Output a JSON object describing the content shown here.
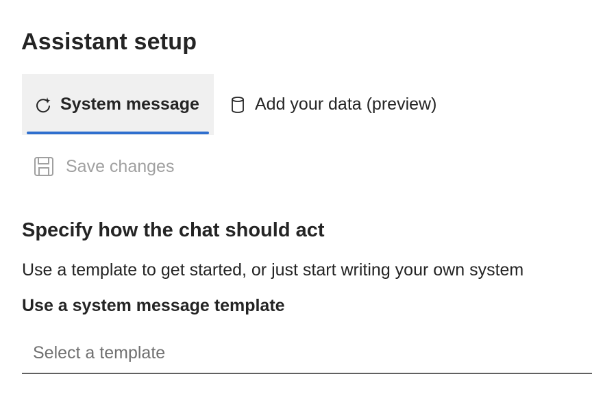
{
  "header": {
    "title": "Assistant setup"
  },
  "tabs": [
    {
      "label": "System message",
      "icon": "sparkle-refresh-icon",
      "selected": true
    },
    {
      "label": "Add your data (preview)",
      "icon": "database-icon",
      "selected": false
    }
  ],
  "toolbar": {
    "save_label": "Save changes",
    "save_icon": "save-icon",
    "save_disabled": true
  },
  "section": {
    "title": "Specify how the chat should act",
    "description": "Use a template to get started, or just start writing your own system"
  },
  "template_field": {
    "label": "Use a system message template",
    "placeholder": "Select a template"
  },
  "colors": {
    "accent": "#2f6fce",
    "tab_selected_bg": "#f0f0f0",
    "disabled_text": "#a0a0a0"
  }
}
